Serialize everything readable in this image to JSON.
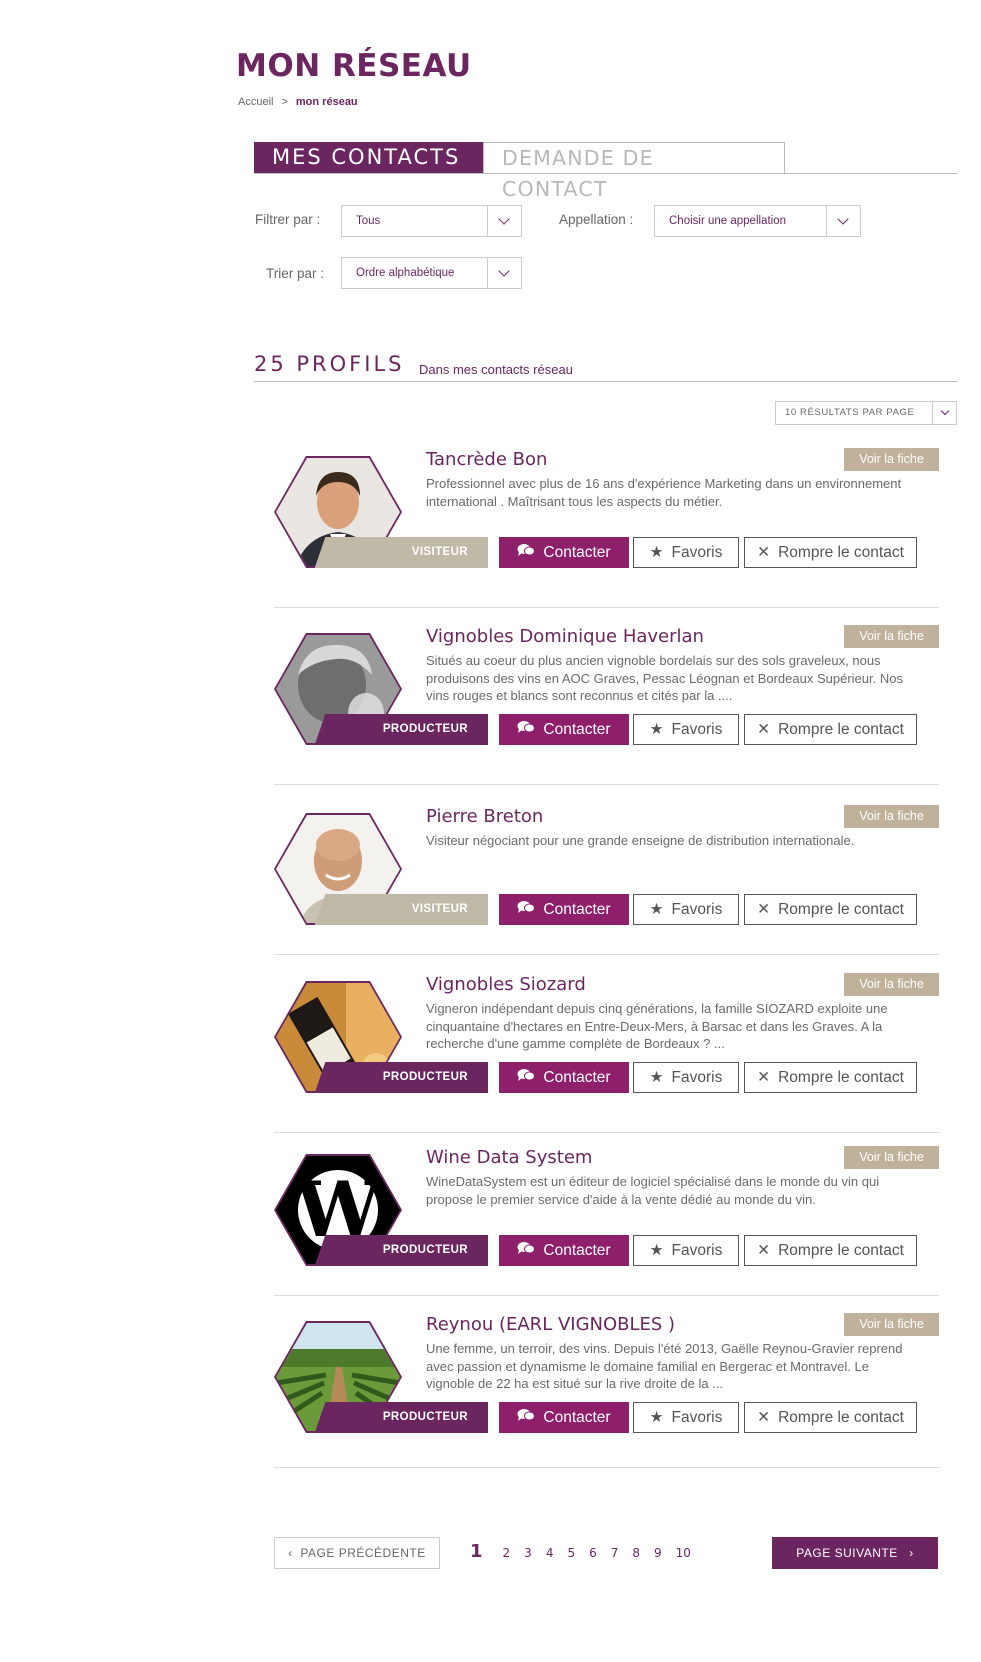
{
  "header": {
    "title": "MON RÉSEAU",
    "breadcrumb": {
      "home": "Accueil",
      "separator": ">",
      "current": "mon réseau"
    }
  },
  "tabs": [
    {
      "label": "MES CONTACTS",
      "active": true
    },
    {
      "label": "DEMANDE DE CONTACT",
      "active": false
    }
  ],
  "filters": {
    "filter_label": "Filtrer par :",
    "filter_value": "Tous",
    "appellation_label": "Appellation :",
    "appellation_value": "Choisir une appellation",
    "sort_label": "Trier par :",
    "sort_value": "Ordre alphabétique"
  },
  "results": {
    "count_label": "25 PROFILS",
    "scope_label": "Dans mes contacts réseau",
    "per_page": "10 RÉSULTATS PAR PAGE"
  },
  "actions": {
    "voir": "Voir la fiche",
    "contact": "Contacter",
    "favoris": "Favoris",
    "rompre": "Rompre le contact"
  },
  "profiles": [
    {
      "name": "Tancrède Bon",
      "type": "VISITEUR",
      "avatar": "man-portrait-suit",
      "description": "Professionnel avec plus de 16 ans d'expérience Marketing dans un environnement international . Maîtrisant tous les aspects du métier."
    },
    {
      "name": "Vignobles Dominique Haverlan",
      "type": "PRODUCTEUR",
      "avatar": "man-tasting-wine-bw",
      "description": "Situés au coeur du plus ancien vignoble bordelais sur des sols graveleux, nous produisons des vins en AOC Graves, Pessac Léognan et Bordeaux Supérieur. Nos vins rouges et blancs sont reconnus et cités par la ...."
    },
    {
      "name": "Pierre Breton",
      "type": "VISITEUR",
      "avatar": "bald-man-smiling",
      "description": "Visiteur négociant pour une grande enseigne de distribution internationale."
    },
    {
      "name": "Vignobles Siozard",
      "type": "PRODUCTEUR",
      "avatar": "wine-bottles",
      "description": "Vigneron indépendant depuis cinq générations, la famille SIOZARD exploite une cinquantaine d'hectares en Entre-Deux-Mers, à Barsac et dans les Graves. A la recherche d'une gamme complète de Bordeaux ? ..."
    },
    {
      "name": "Wine Data System",
      "type": "PRODUCTEUR",
      "avatar": "w-logo",
      "description": "WineDataSystem est un éditeur de logiciel spécialisé dans le monde du vin qui propose le premier service d'aide à la vente dédié au monde du vin."
    },
    {
      "name": "Reynou (EARL VIGNOBLES )",
      "type": "PRODUCTEUR",
      "avatar": "vineyard-rows",
      "description": "Une femme, un terroir, des vins. Depuis l'été 2013, Gaëlle Reynou-Gravier reprend avec passion et dynamisme le domaine familial en Bergerac et Montravel. Le vignoble de 22 ha est situé sur la rive droite de la ..."
    }
  ],
  "pagination": {
    "prev": "PAGE PRÉCÉDENTE",
    "next": "PAGE SUIVANTE",
    "current": "1",
    "pages": [
      "2",
      "3",
      "4",
      "5",
      "6",
      "7",
      "8",
      "9",
      "10"
    ]
  },
  "colors": {
    "brand": "#6b2660",
    "contact": "#8e1f6a",
    "visitor_badge": "#c0b9a8",
    "voir_badge": "#c0b29a"
  }
}
